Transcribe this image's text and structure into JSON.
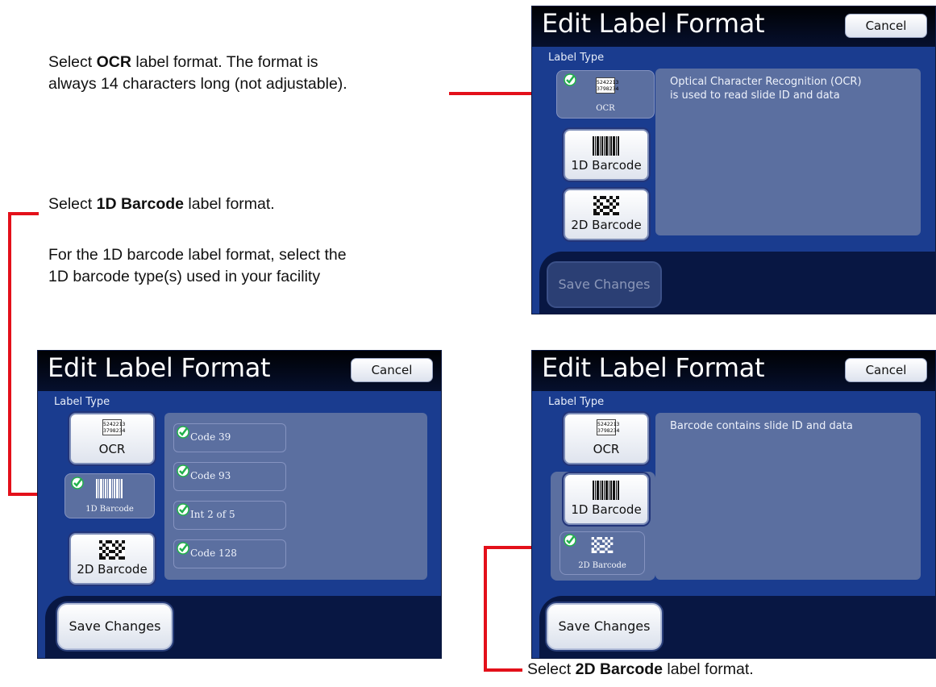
{
  "captions": {
    "ocr_bold": "OCR",
    "ocr_pre": "Select ",
    "ocr_post": " label format. The format is",
    "ocr_line2": "always 14 characters long (not adjustable).",
    "bc1_pre": "Select ",
    "bc1_bold": "1D Barcode",
    "bc1_post": " label format.",
    "bc1_note_line1": "For the 1D barcode label format, select the",
    "bc1_note_line2": "1D barcode type(s) used in your facility",
    "bc2_pre": "Select ",
    "bc2_bold": "2D Barcode",
    "bc2_post": " label format."
  },
  "screen_common": {
    "title": "Edit Label Format",
    "cancel": "Cancel",
    "label_type": "Label Type",
    "save_changes": "Save Changes",
    "ocr_button": "OCR",
    "bc1_button": "1D Barcode",
    "bc2_button": "2D Barcode",
    "ocr_icon_line1": "5242213",
    "ocr_icon_line2": "3798234"
  },
  "screen_ocr": {
    "description_line1": "Optical Character Recognition (OCR)",
    "description_line2": "is used to read slide ID and data",
    "selected": "OCR",
    "save_enabled": false
  },
  "screen_1d": {
    "selected": "1D Barcode",
    "save_enabled": true,
    "barcode_types": [
      "Code 39",
      "Code 93",
      "Int 2 of 5",
      "Code 128"
    ]
  },
  "screen_2d": {
    "description": "Barcode contains slide ID and data",
    "selected": "2D Barcode",
    "save_enabled": true
  },
  "colors": {
    "panel_bg": "#1a3c8f",
    "content_bg": "#5b6fa0",
    "footer_bg": "#081743",
    "callout_red": "#e3101a",
    "check_green": "#22b14c"
  }
}
